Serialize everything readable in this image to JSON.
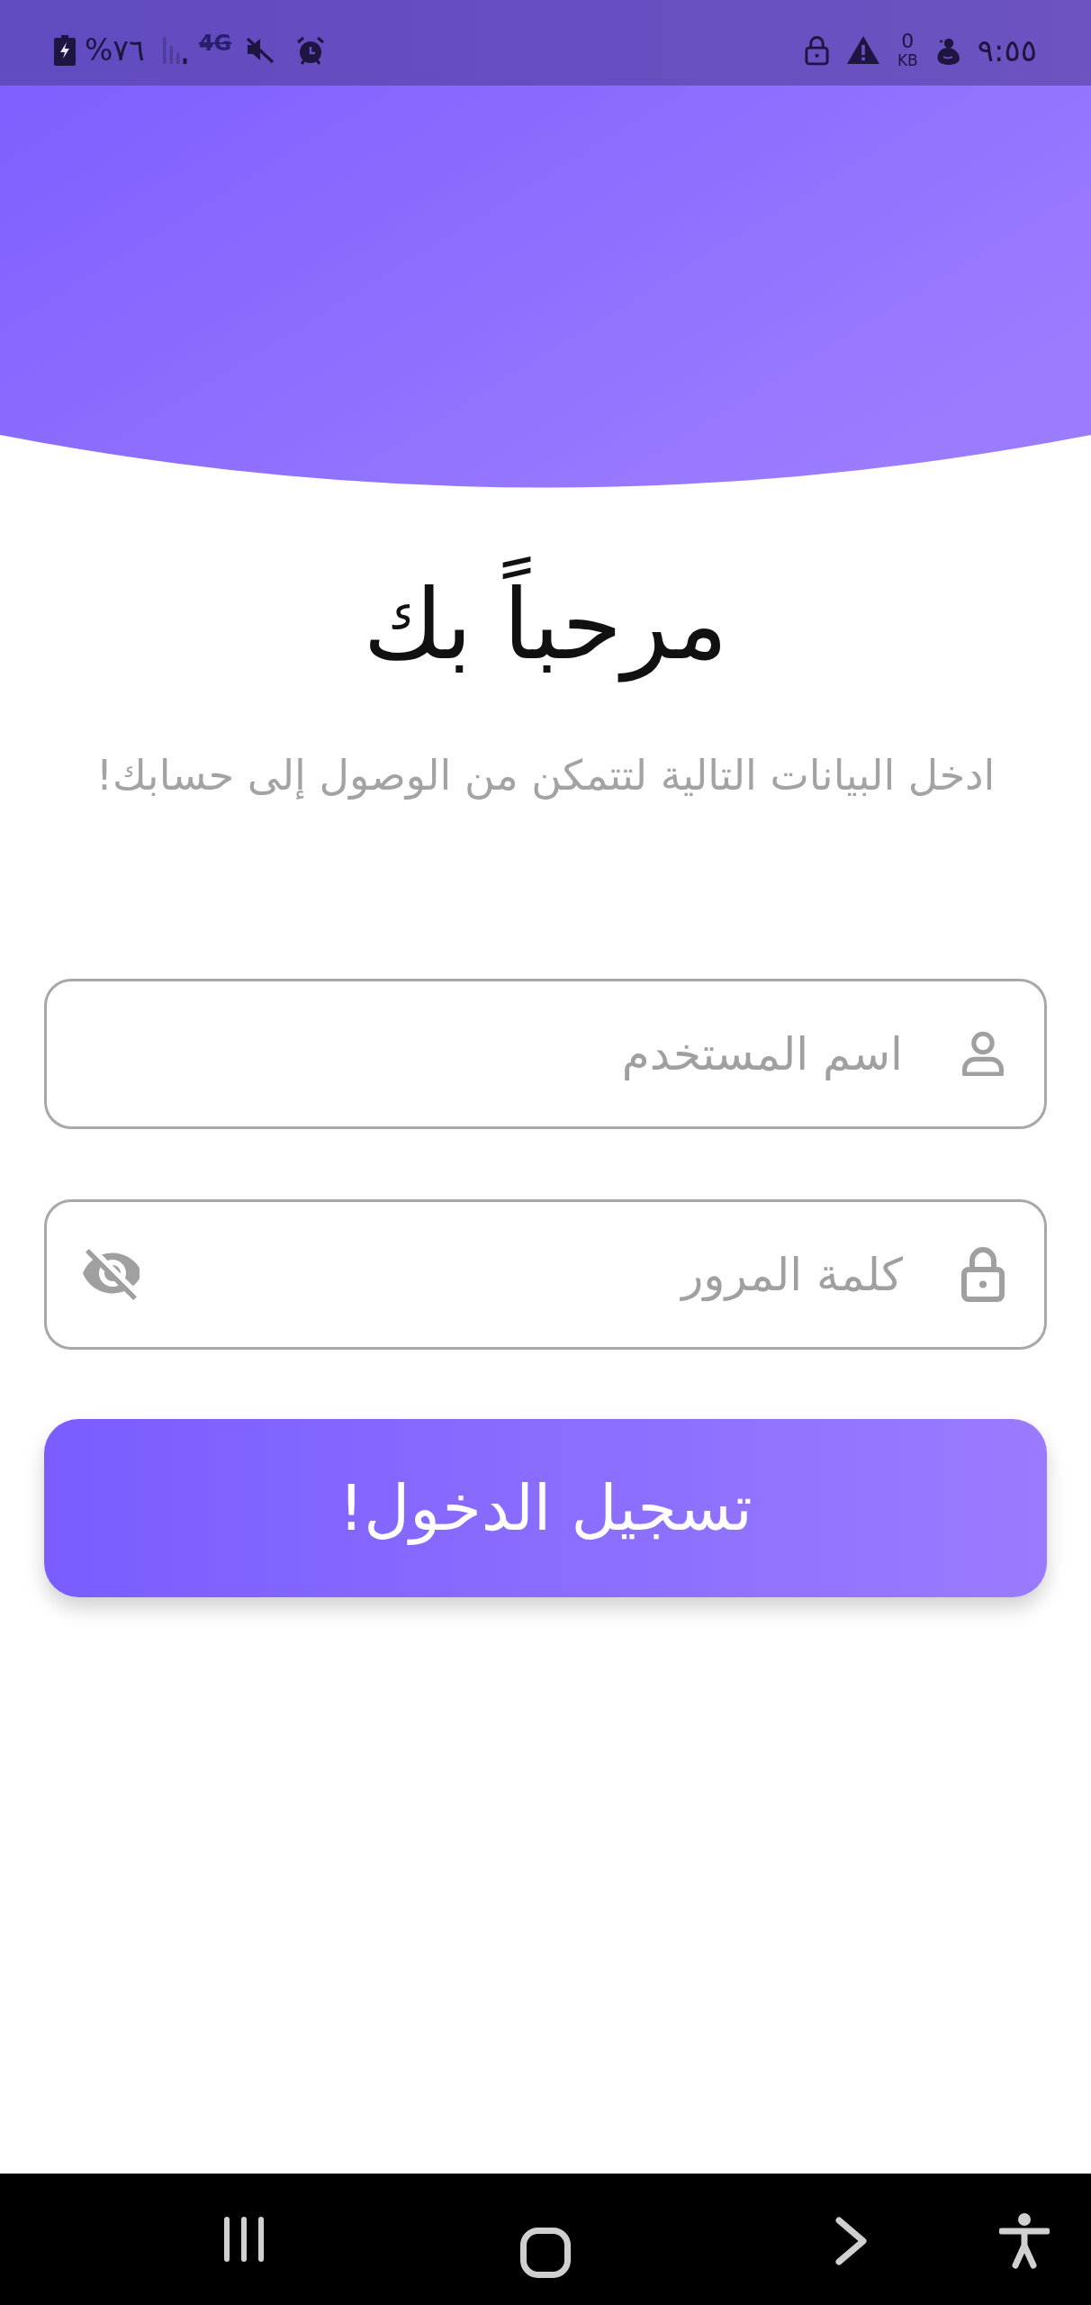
{
  "status_bar": {
    "battery": "%٧٦",
    "network": "4G",
    "data_speed": {
      "value": "0",
      "unit": "KB"
    },
    "time": "٩:٥٥"
  },
  "welcome": {
    "title": "مرحباً بك",
    "subtitle": "ادخل البيانات التالية لتتمكن من الوصول إلى حسابك!"
  },
  "fields": [
    {
      "kind": "text",
      "placeholder": "اسم المستخدم"
    },
    {
      "kind": "password",
      "placeholder": "كلمة المرور",
      "password_visible": false
    }
  ],
  "login_button": {
    "label": "تسجيل الدخول!"
  }
}
